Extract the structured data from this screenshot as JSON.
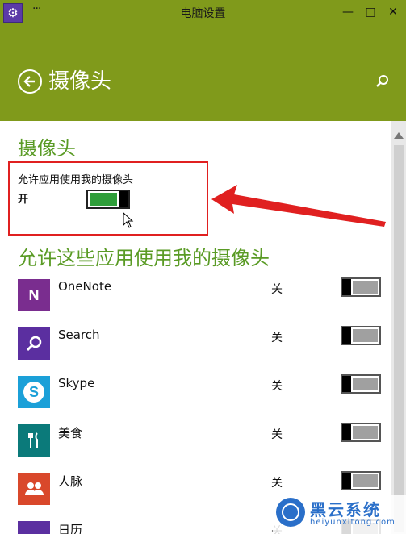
{
  "titlebar": {
    "title": "电脑设置",
    "dots": "···",
    "minimize": "—",
    "maximize": "□",
    "close": "✕"
  },
  "header": {
    "title": "摄像头"
  },
  "section": {
    "title": "摄像头",
    "allow_label": "允许应用使用我的摄像头",
    "toggle_state": "开",
    "toggle_on": true
  },
  "apps_section": {
    "title": "允许这些应用使用我的摄像头"
  },
  "apps": [
    {
      "name": "OneNote",
      "state": "关",
      "color": "#7a2d8f",
      "icon": "onenote-icon"
    },
    {
      "name": "Search",
      "state": "关",
      "color": "#5b2fa0",
      "icon": "search-icon"
    },
    {
      "name": "Skype",
      "state": "关",
      "color": "#1ba0d8",
      "icon": "skype-icon"
    },
    {
      "name": "美食",
      "state": "关",
      "color": "#0b7a7a",
      "icon": "food-icon"
    },
    {
      "name": "人脉",
      "state": "关",
      "color": "#d9482b",
      "icon": "people-icon"
    },
    {
      "name": "日历",
      "state": "关",
      "color": "#5b2fa0",
      "icon": "calendar-icon"
    }
  ],
  "watermark": {
    "brand": "黑云系统",
    "domain": "heiyunxitong.com"
  },
  "colors": {
    "accent": "#809a1b",
    "heading": "#5a9b25",
    "toggle_on": "#2f9e3a",
    "callout": "#e02020"
  }
}
